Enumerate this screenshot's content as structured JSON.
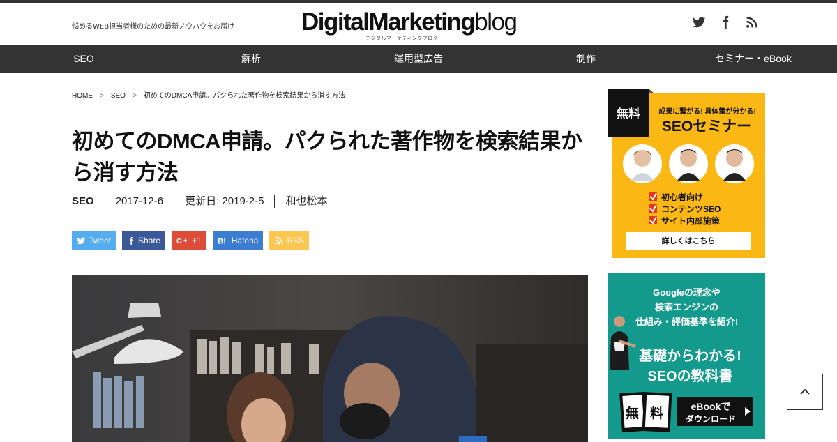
{
  "header": {
    "tagline": "悩めるWEB担当者様のための最新ノウハウをお届け",
    "logo_bold": "DigitalMarketing",
    "logo_light": "blog",
    "logo_sub": "デジタルマーケティングブログ",
    "social_icons": [
      "twitter-icon",
      "facebook-icon",
      "rss-icon"
    ]
  },
  "nav": {
    "items": [
      "SEO",
      "解析",
      "運用型広告",
      "制作",
      "セミナー・eBook"
    ]
  },
  "breadcrumb": {
    "home": "HOME",
    "sep": ">",
    "category": "SEO",
    "current": "初めてのDMCA申請。パクられた著作物を検索結果から消す方法"
  },
  "article": {
    "title": "初めてのDMCA申請。パクられた著作物を検索結果から消す方法",
    "category": "SEO",
    "date": "2017-12-6",
    "updated": "更新日: 2019-2-5",
    "author": "和也松本"
  },
  "share": {
    "tweet": "Tweet",
    "share": "Share",
    "gplus": "+1",
    "hatena": "Hatena",
    "rss": "RSS",
    "colors": {
      "tweet": "#55acee",
      "share": "#3b5998",
      "gplus": "#dd4b39",
      "hatena": "#3c7dd1",
      "rss": "#fcc650"
    }
  },
  "banner1": {
    "badge": "無料",
    "tagline": "成果に繋がる! 具体策が分かる!",
    "title": "SEOセミナー",
    "points": [
      "初心者向け",
      "コンテンツSEO",
      "サイト内部施策"
    ],
    "cta": "詳しくはこちら",
    "colors": {
      "bg": "#fbb814",
      "badge": "#111"
    }
  },
  "banner2": {
    "lead1": "Googleの理念や",
    "lead2": "検索エンジンの",
    "lead3": "仕組み・評価基準を紹介!",
    "title1": "基礎からわかる!",
    "title2": "SEOの教科書",
    "book1": "無",
    "book2": "料",
    "cta1": "eBookで",
    "cta2": "ダウンロード",
    "colors": {
      "bg": "#149a8c"
    }
  },
  "totop": {
    "icon": "chevron-up-icon"
  }
}
